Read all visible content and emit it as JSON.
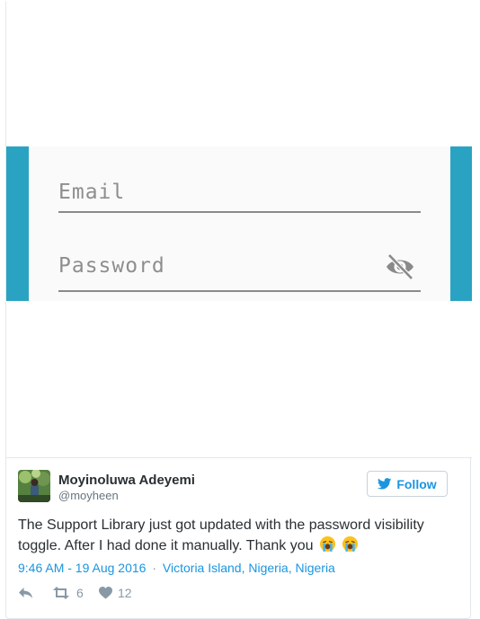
{
  "media": {
    "email_hint": "Email",
    "password_hint": "Password",
    "visibility_icon": "eye-off-icon",
    "accent_color": "#2aa3c3"
  },
  "tweet": {
    "author_name": "Moyinoluwa Adeyemi",
    "author_handle": "@moyheen",
    "follow_label": "Follow",
    "text": "The Support Library just got updated with the password visibility toggle. After I had done it manually. Thank you",
    "emoji": "loudly-crying-face",
    "timestamp": "9:46 AM - 19 Aug 2016",
    "separator": "·",
    "location": "Victoria Island, Nigeria, Nigeria",
    "retweets": "6",
    "likes": "12",
    "link_color": "#1b95e0"
  }
}
